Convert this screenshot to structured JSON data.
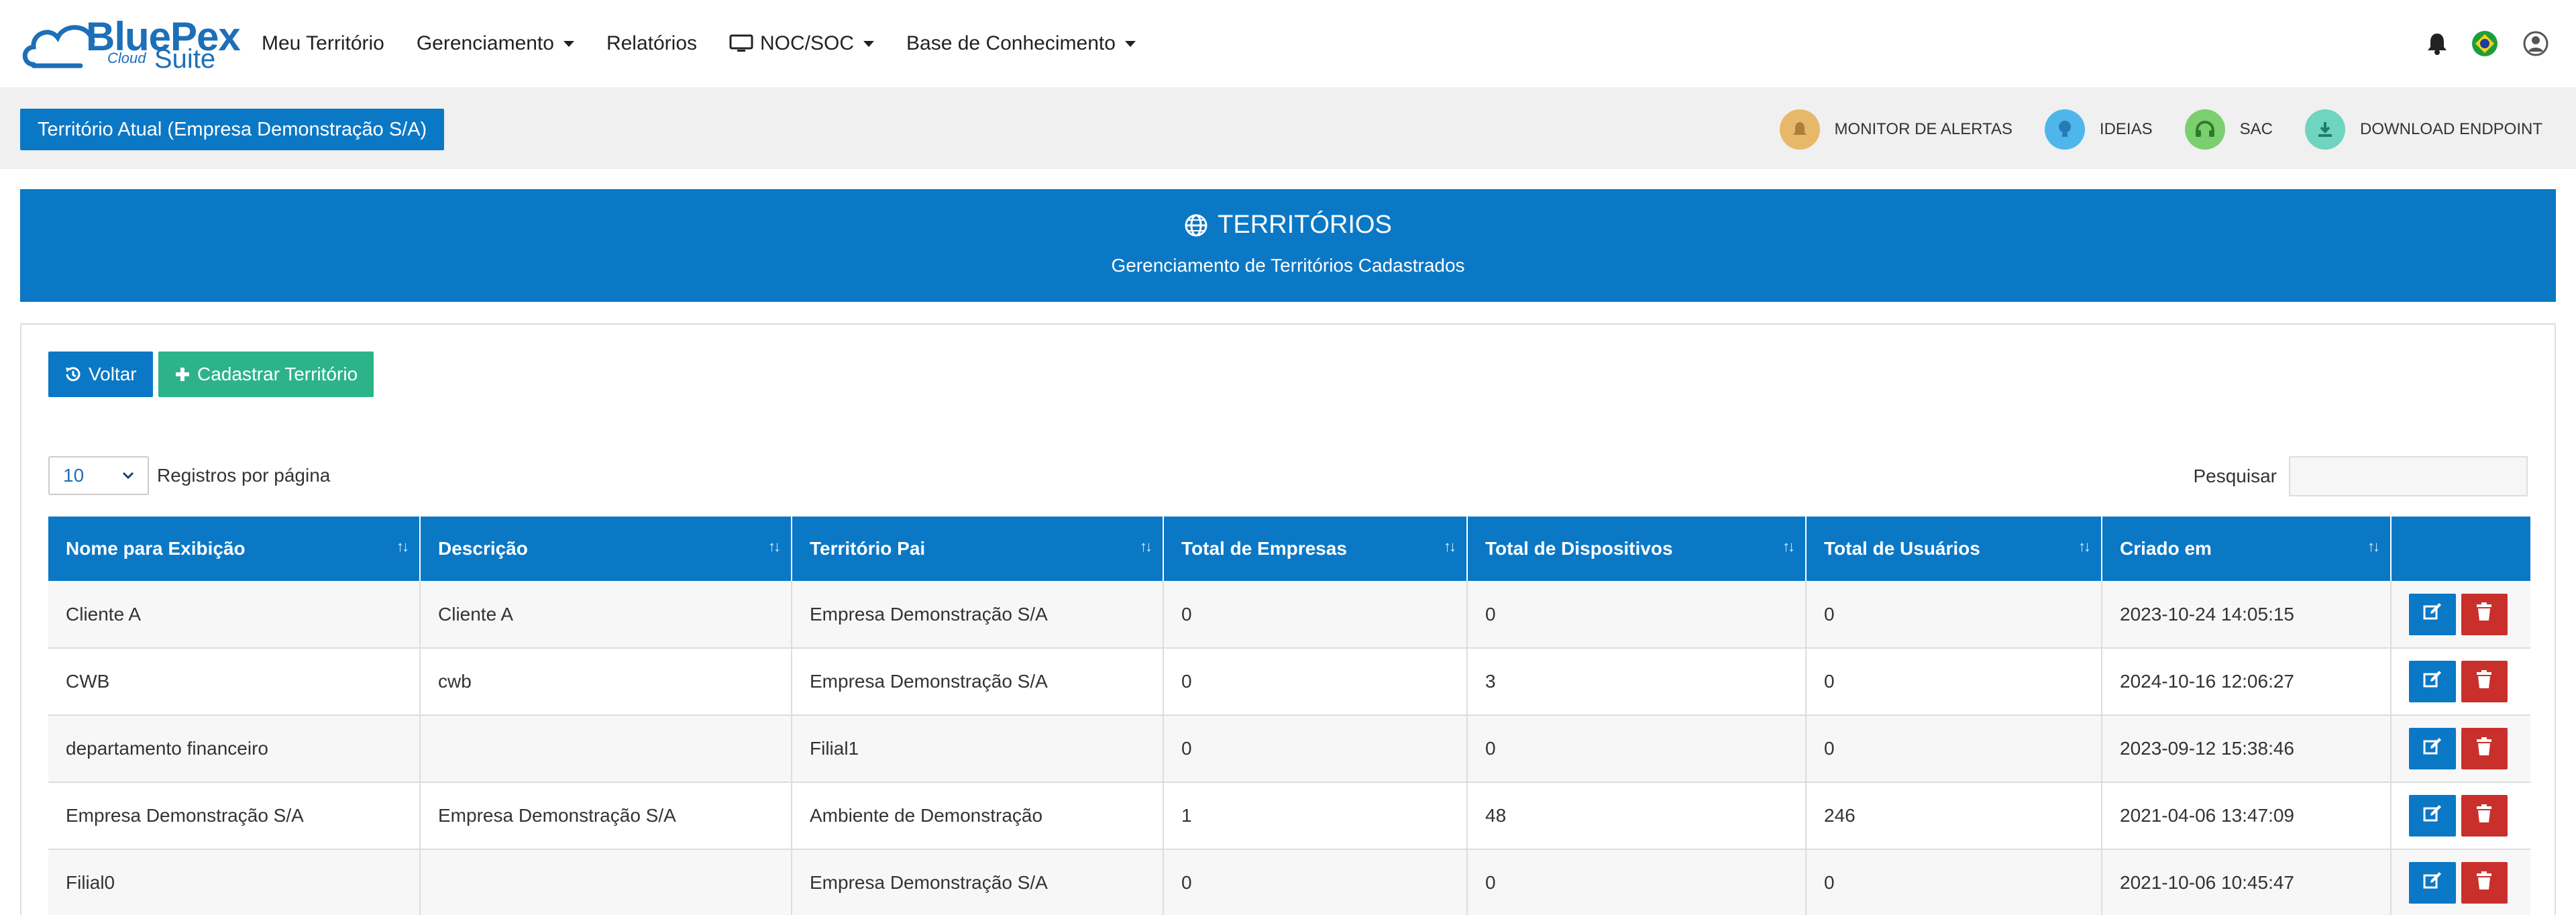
{
  "logo": {
    "brand": "BluePex",
    "cloud": "Cloud",
    "suite": "Suite"
  },
  "nav": {
    "items": [
      {
        "label": "Meu Território",
        "dropdown": false,
        "icon": ""
      },
      {
        "label": "Gerenciamento",
        "dropdown": true,
        "icon": ""
      },
      {
        "label": "Relatórios",
        "dropdown": false,
        "icon": ""
      },
      {
        "label": "NOC/SOC",
        "dropdown": true,
        "icon": "monitor-icon"
      },
      {
        "label": "Base de Conhecimento",
        "dropdown": true,
        "icon": ""
      }
    ]
  },
  "subbar": {
    "territory_button": "Território Atual (Empresa Demonstração S/A)",
    "links": [
      {
        "label": "MONITOR DE ALERTAS",
        "icon": "bell-icon",
        "color": "#e8b86a"
      },
      {
        "label": "IDEIAS",
        "icon": "lightbulb-icon",
        "color": "#4fb6ec"
      },
      {
        "label": "SAC",
        "icon": "headset-icon",
        "color": "#7bcf6f"
      },
      {
        "label": "DOWNLOAD ENDPOINT",
        "icon": "download-icon",
        "color": "#6fd4c0"
      }
    ]
  },
  "banner": {
    "title": "TERRITÓRIOS",
    "subtitle": "Gerenciamento de Territórios Cadastrados"
  },
  "toolbar": {
    "back_label": "Voltar",
    "add_label": "Cadastrar Território"
  },
  "table_controls": {
    "page_length": "10",
    "page_length_label": "Registros por página",
    "search_label": "Pesquisar",
    "search_value": ""
  },
  "table": {
    "columns": [
      "Nome para Exibição",
      "Descrição",
      "Território Pai",
      "Total de Empresas",
      "Total de Dispositivos",
      "Total de Usuários",
      "Criado em"
    ],
    "rows": [
      [
        "Cliente A",
        "Cliente A",
        "Empresa Demonstração S/A",
        "0",
        "0",
        "0",
        "2023-10-24 14:05:15"
      ],
      [
        "CWB",
        "cwb",
        "Empresa Demonstração S/A",
        "0",
        "3",
        "0",
        "2024-10-16 12:06:27"
      ],
      [
        "departamento financeiro",
        "",
        "Filial1",
        "0",
        "0",
        "0",
        "2023-09-12 15:38:46"
      ],
      [
        "Empresa Demonstração S/A",
        "Empresa Demonstração S/A",
        "Ambiente de Demonstração",
        "1",
        "48",
        "246",
        "2021-04-06 13:47:09"
      ],
      [
        "Filial0",
        "",
        "Empresa Demonstração S/A",
        "0",
        "0",
        "0",
        "2021-10-06 10:45:47"
      ]
    ]
  },
  "colors": {
    "primary": "#0b78c6",
    "success": "#2db38a",
    "danger": "#c9302c"
  }
}
